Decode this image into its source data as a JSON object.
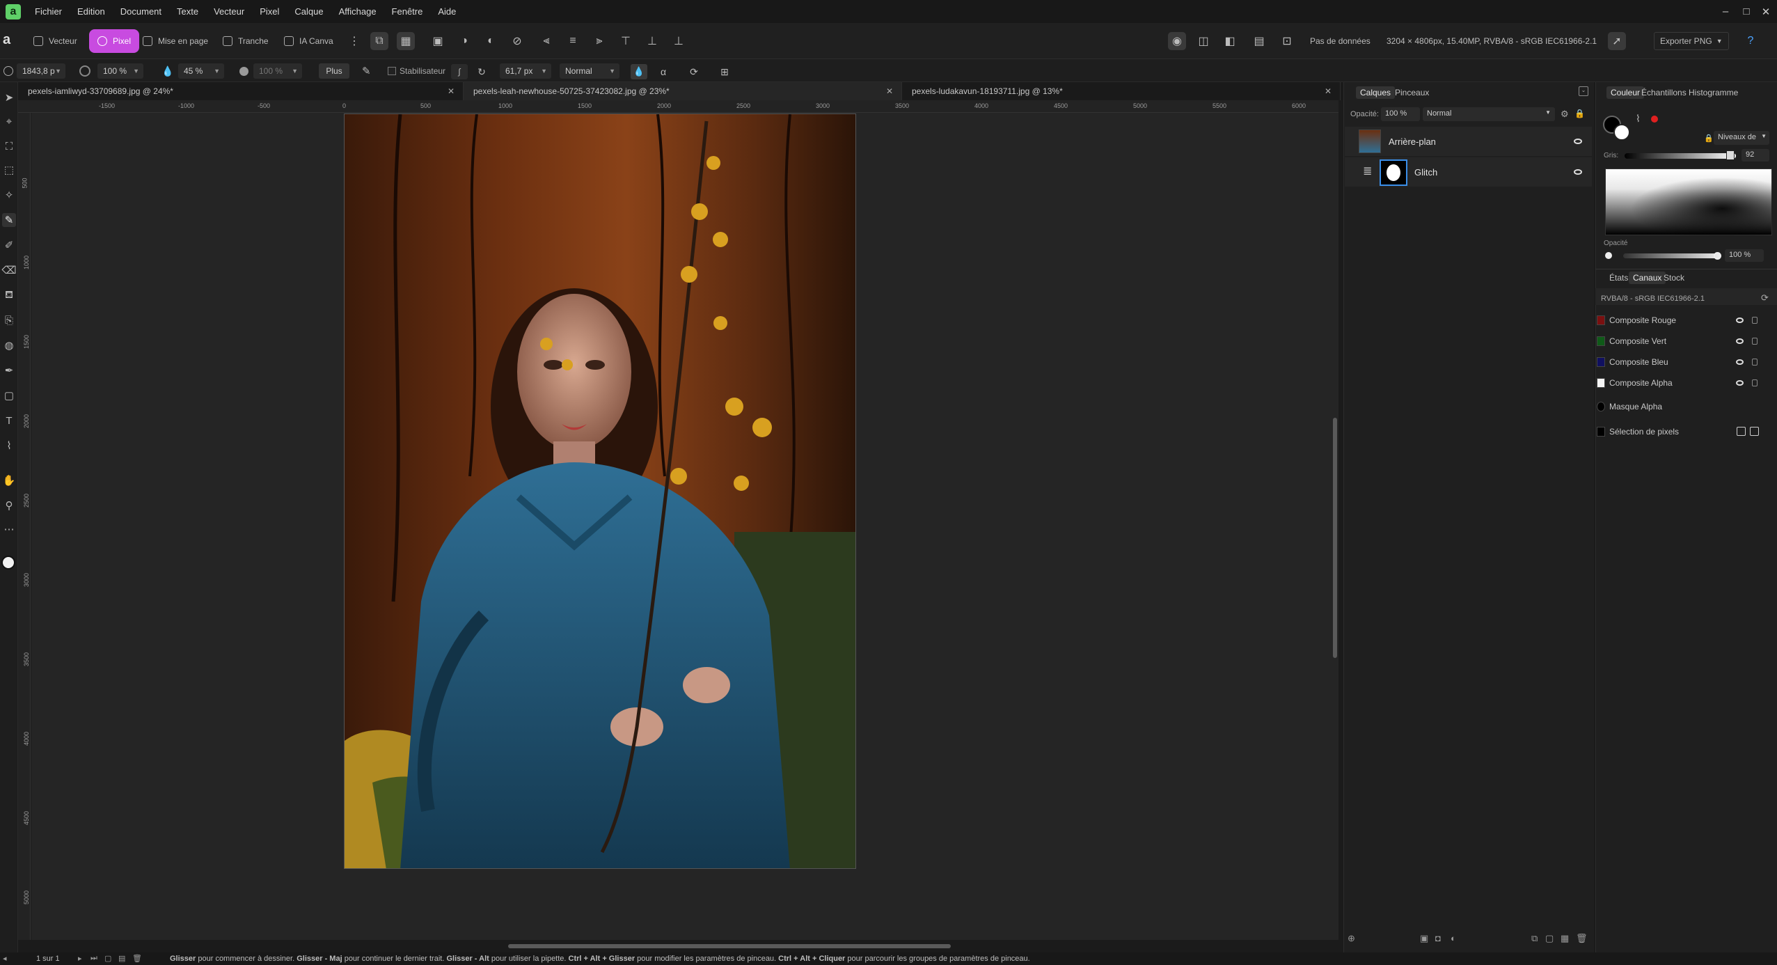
{
  "app": {
    "menu": [
      "Fichier",
      "Edition",
      "Document",
      "Texte",
      "Vecteur",
      "Pixel",
      "Calque",
      "Affichage",
      "Fenêtre",
      "Aide"
    ]
  },
  "personas": {
    "vector": "Vecteur",
    "pixel": "Pixel",
    "layout": "Mise en page",
    "slice": "Tranche",
    "ai": "IA Canva"
  },
  "status": {
    "no_data": "Pas de données",
    "doc_info": "3204 × 4806px, 15.40MP, RVBA/8 - sRGB IEC61966-2.1",
    "export": "Exporter PNG"
  },
  "context_bar": {
    "width": "1843,8 p",
    "opacity": "100 %",
    "flow": "45 %",
    "hardness": "100 %",
    "more": "Plus",
    "stabilizer": "Stabilisateur",
    "size": "61,7 px",
    "blend": "Normal"
  },
  "tabs": [
    {
      "label": "pexels-iamliwyd-33709689.jpg @ 24%*"
    },
    {
      "label": "pexels-leah-newhouse-50725-37423082.jpg @ 23%*"
    },
    {
      "label": "pexels-ludakavun-18193711.jpg @ 13%*"
    }
  ],
  "ruler": {
    "h": [
      "-1500",
      "-1000",
      "-500",
      "0",
      "500",
      "1000",
      "1500",
      "2000",
      "2500",
      "3000",
      "3500",
      "4000",
      "4500",
      "5000",
      "5500",
      "6000"
    ],
    "v": [
      "500",
      "1000",
      "1500",
      "2000",
      "2500",
      "3000",
      "3500",
      "4000",
      "4500",
      "5000"
    ]
  },
  "layers_panel": {
    "tabs": [
      "Calques",
      "Pinceaux"
    ],
    "opacity_label": "Opacité:",
    "opacity": "100 %",
    "blend": "Normal",
    "layers": [
      {
        "name": "Arrière-plan"
      },
      {
        "name": "Glitch"
      }
    ]
  },
  "color_panel": {
    "tabs": [
      "Couleur",
      "Échantillons",
      "Histogramme"
    ],
    "mode": "Niveaux de",
    "gray_label": "Gris:",
    "gray_value": "92",
    "opacity_label": "Opacité",
    "opacity_value": "100 %",
    "accent": "#e02020"
  },
  "channels_panel": {
    "tabs": [
      "États",
      "Canaux",
      "Stock"
    ],
    "profile": "RVBA/8 - sRGB IEC61966-2.1",
    "channels": [
      {
        "name": "Composite Rouge",
        "color": "#7a1010"
      },
      {
        "name": "Composite Vert",
        "color": "#0f5a18"
      },
      {
        "name": "Composite Bleu",
        "color": "#101060"
      },
      {
        "name": "Composite Alpha",
        "color": "#f4f4f4"
      },
      {
        "name": "Masque Alpha",
        "color": "#000000"
      },
      {
        "name": "Sélection de pixels",
        "color": "#000000"
      }
    ]
  },
  "statusbar": {
    "page": "1 sur 1",
    "hint_parts": [
      {
        "b": "Glisser",
        "t": " pour commencer à dessiner. "
      },
      {
        "b": "Glisser - Maj",
        "t": " pour continuer le dernier trait. "
      },
      {
        "b": "Glisser - Alt",
        "t": " pour utiliser la pipette. "
      },
      {
        "b": "Ctrl + Alt + Glisser",
        "t": " pour modifier les paramètres de pinceau. "
      },
      {
        "b": "Ctrl + Alt + Cliquer",
        "t": " pour parcourir les groupes de paramètres de pinceau."
      }
    ]
  }
}
